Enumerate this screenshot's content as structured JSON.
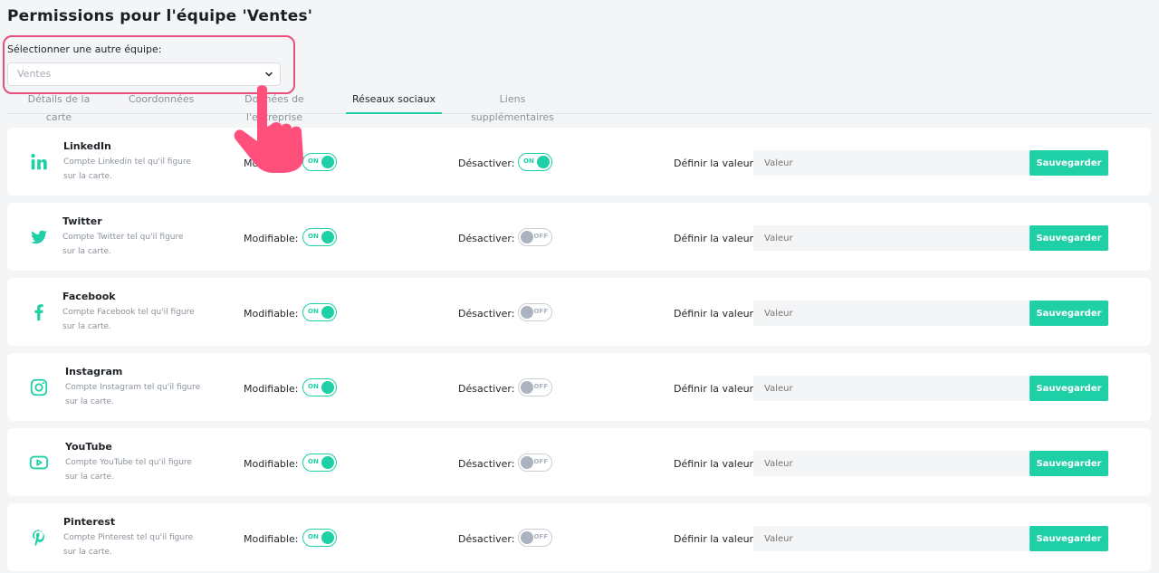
{
  "page": {
    "title": "Permissions pour l'équipe 'Ventes'"
  },
  "team_select": {
    "label": "Sélectionner une autre équipe:",
    "value": "Ventes"
  },
  "tabs": [
    {
      "label": "Détails de la carte",
      "active": false
    },
    {
      "label": "Coordonnées",
      "active": false
    },
    {
      "label": "Données de l'entreprise",
      "active": false
    },
    {
      "label": "Réseaux sociaux",
      "active": true
    },
    {
      "label": "Liens supplémentaires",
      "active": false
    }
  ],
  "labels": {
    "modifiable": "Modifiable:",
    "deactivate": "Désactiver:",
    "set_value": "Définir la valeur:",
    "value_placeholder": "Valeur",
    "save": "Sauvegarder",
    "on": "ON",
    "off": "OFF"
  },
  "networks": [
    {
      "icon": "linkedin-icon",
      "name": "LinkedIn",
      "description": "Compte Linkedin tel qu'il figure sur la carte.",
      "modifiable": true,
      "deactivate": true
    },
    {
      "icon": "twitter-icon",
      "name": "Twitter",
      "description": "Compte Twitter tel qu'il figure sur la carte.",
      "modifiable": true,
      "deactivate": false
    },
    {
      "icon": "facebook-icon",
      "name": "Facebook",
      "description": "Compte Facebook tel qu'il figure sur la carte.",
      "modifiable": true,
      "deactivate": false
    },
    {
      "icon": "instagram-icon",
      "name": "Instagram",
      "description": "Compte Instagram tel qu'il figure sur la carte.",
      "modifiable": true,
      "deactivate": false
    },
    {
      "icon": "youtube-icon",
      "name": "YouTube",
      "description": "Compte YouTube tel qu'il figure sur la carte.",
      "modifiable": true,
      "deactivate": false
    },
    {
      "icon": "pinterest-icon",
      "name": "Pinterest",
      "description": "Compte Pinterest tel qu'il figure sur la carte.",
      "modifiable": true,
      "deactivate": false
    }
  ],
  "colors": {
    "accent": "#1fcfa6",
    "highlight": "#e8507a",
    "off": "#aab3bf"
  }
}
